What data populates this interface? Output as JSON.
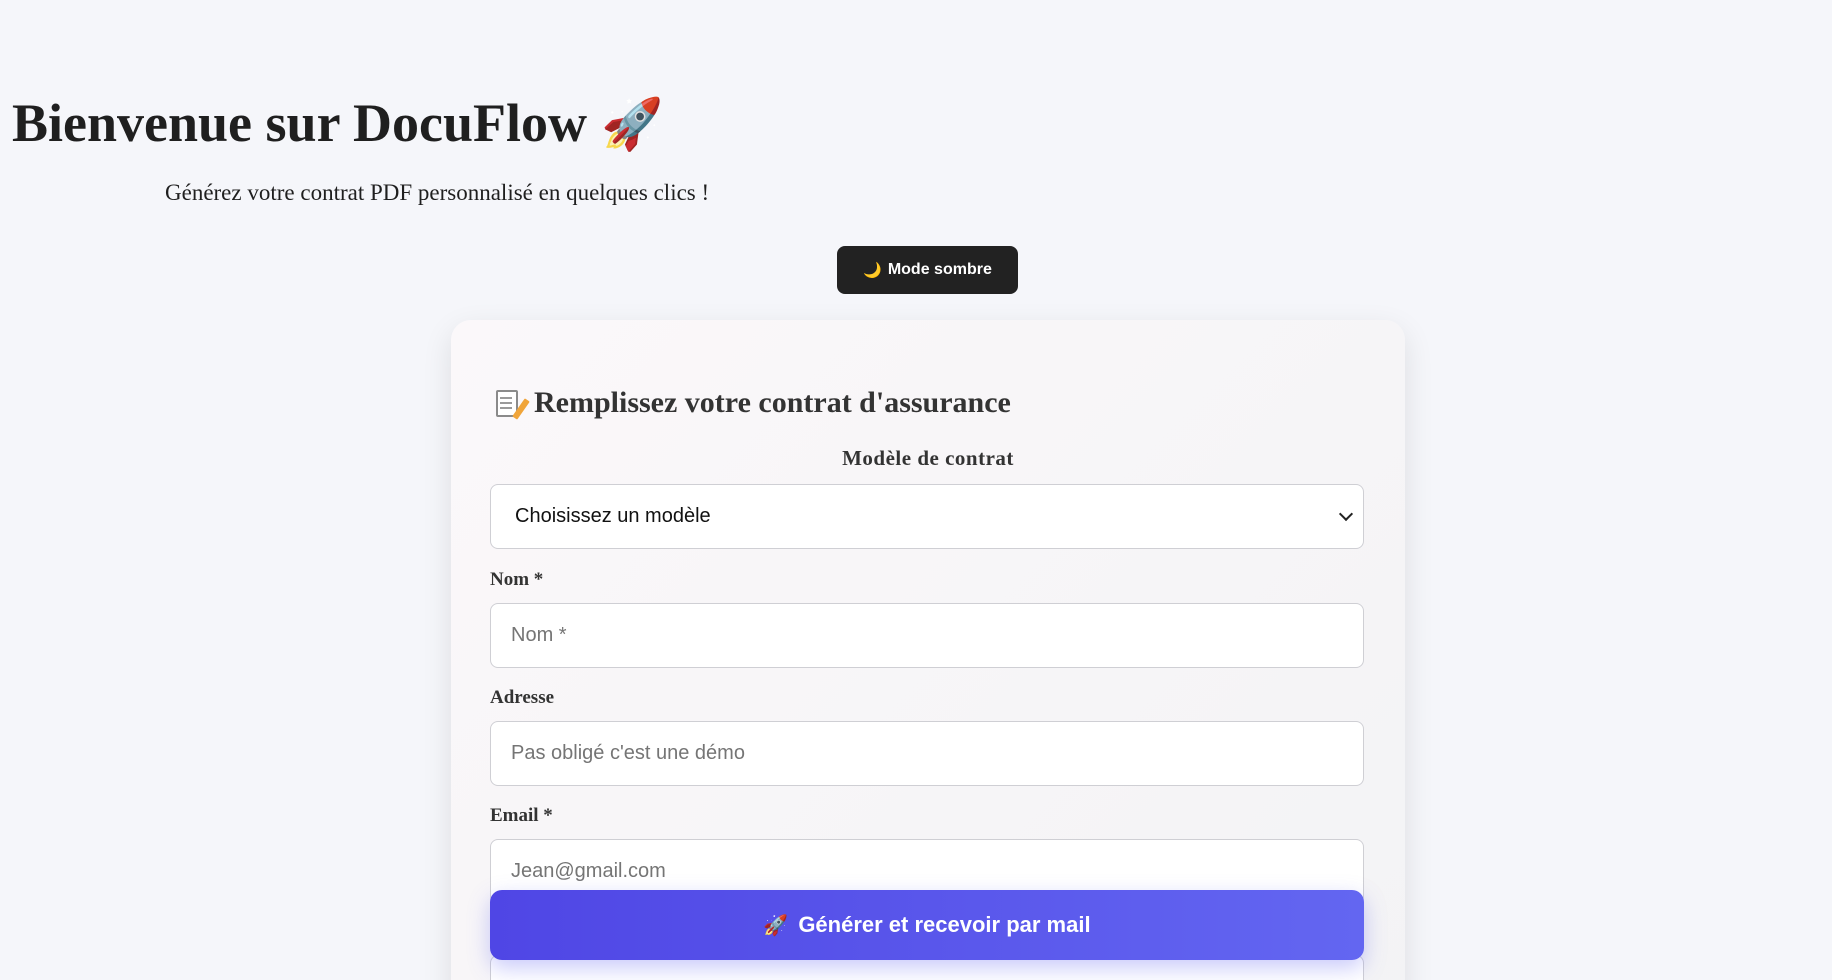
{
  "header": {
    "title": "Bienvenue sur DocuFlow",
    "title_icon": "rocket-icon",
    "title_emoji": "🚀",
    "subtitle": "Générez votre contrat PDF personnalisé en quelques clics !"
  },
  "theme_toggle": {
    "icon": "moon-icon",
    "icon_glyph": "🌙",
    "label": "Mode sombre"
  },
  "form": {
    "title": "Remplissez votre contrat d'assurance",
    "title_icon": "memo-icon",
    "template": {
      "label": "Modèle de contrat",
      "selected": "Choisissez un modèle"
    },
    "fields": {
      "nom": {
        "label": "Nom *",
        "placeholder": "Nom *",
        "value": ""
      },
      "adresse": {
        "label": "Adresse",
        "placeholder": "Pas obligé c'est une démo",
        "value": ""
      },
      "email": {
        "label": "Email *",
        "placeholder": "Jean@gmail.com",
        "value": ""
      }
    },
    "submit": {
      "icon": "rocket-icon",
      "icon_glyph": "🚀",
      "label": "Générer et recevoir par mail"
    }
  },
  "colors": {
    "background": "#f5f6fa",
    "dark_button": "#222222",
    "accent_start": "#4f46e5",
    "accent_end": "#6366f1"
  }
}
